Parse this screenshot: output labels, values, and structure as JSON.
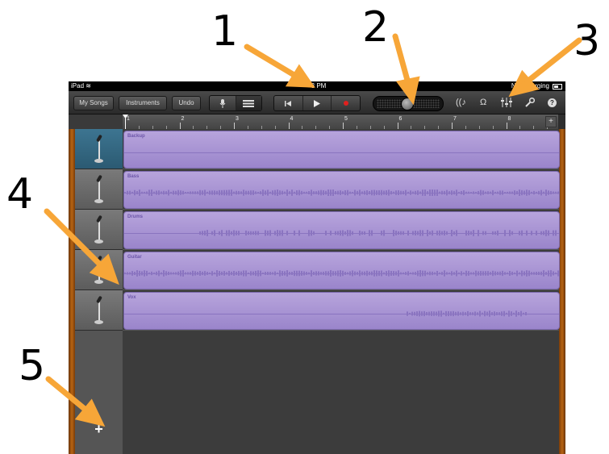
{
  "status": {
    "device": "iPad",
    "wifi_icon": "wifi-icon",
    "time": "3 PM",
    "recording": "Not Charging",
    "battery_icon": "battery-icon"
  },
  "toolbar": {
    "my_songs": "My Songs",
    "instruments": "Instruments",
    "undo": "Undo",
    "mic_icon": "mic-icon",
    "tracks_view_icon": "tracks-view-icon",
    "rewind_icon": "rewind-icon",
    "play_icon": "play-icon",
    "record_icon": "record-icon",
    "loops_icon": "loops-icon",
    "metronome_icon": "metronome-icon",
    "mixer_icon": "mixer-icon",
    "settings_icon": "wrench-icon",
    "help": "?"
  },
  "ruler": {
    "bars": [
      "1",
      "2",
      "3",
      "4",
      "5",
      "6",
      "7",
      "8"
    ],
    "add": "+"
  },
  "tracks": [
    {
      "name": "Backup",
      "selected": true
    },
    {
      "name": "Bass",
      "selected": false
    },
    {
      "name": "Drums",
      "selected": false
    },
    {
      "name": "Guitar",
      "selected": false
    },
    {
      "name": "Vox",
      "selected": false
    }
  ],
  "add_track": "+",
  "annotations": [
    "1",
    "2",
    "3",
    "4",
    "5"
  ],
  "colors": {
    "accent": "#f7a638",
    "region": "#a896d3",
    "selected_header": "#2f6580"
  }
}
